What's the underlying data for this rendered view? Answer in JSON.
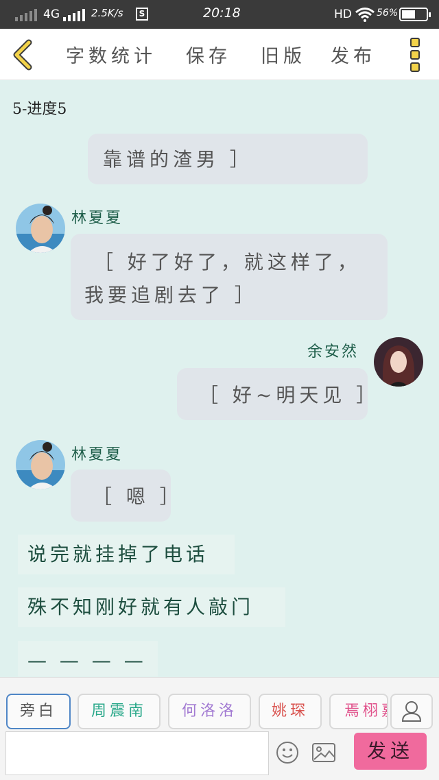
{
  "status_bar": {
    "network": "4G",
    "speed": "2.5K/s",
    "s_badge": "S",
    "time": "20:18",
    "hd": "HD",
    "battery_pct": "56%",
    "battery_level": 0.56
  },
  "toolbar": {
    "word_count_label": "字数统计",
    "save_label": "保存",
    "old_version_label": "旧版",
    "publish_label": "发布"
  },
  "chapter_title": "5-进度5",
  "messages": [
    {
      "type": "bubble-left",
      "text_line1": "靠谱的渣男 ］"
    },
    {
      "type": "left",
      "name": "林夏夏",
      "text_line1": "［ 好了好了，就这样了，",
      "text_line2": "我要追剧去了 ］"
    },
    {
      "type": "right",
      "name": "余安然",
      "text_line1": "［ 好~明天见 ］"
    },
    {
      "type": "left",
      "name": "林夏夏",
      "text_line1": "［ 嗯 ］"
    },
    {
      "type": "narration",
      "text_line1": "说完就挂掉了电话"
    },
    {
      "type": "narration",
      "text_line1": "殊不知刚好就有人敲门"
    },
    {
      "type": "narration",
      "text_line1": "— — — — —"
    }
  ],
  "roles": [
    {
      "label": "旁白",
      "color": "#555555"
    },
    {
      "label": "周震南",
      "color": "#2aa88a"
    },
    {
      "label": "何洛洛",
      "color": "#a27ad2"
    },
    {
      "label": "姚琛",
      "color": "#d9534f"
    },
    {
      "label": "焉栩嘉",
      "color": "#e0508a"
    }
  ],
  "input": {
    "placeholder": "",
    "send_label": "发送"
  },
  "colors": {
    "chat_bg": "#dff1ee",
    "bubble_bg": "#e0e5ea",
    "send_button": "#f06a9d",
    "name_color": "#1f5e4a"
  }
}
